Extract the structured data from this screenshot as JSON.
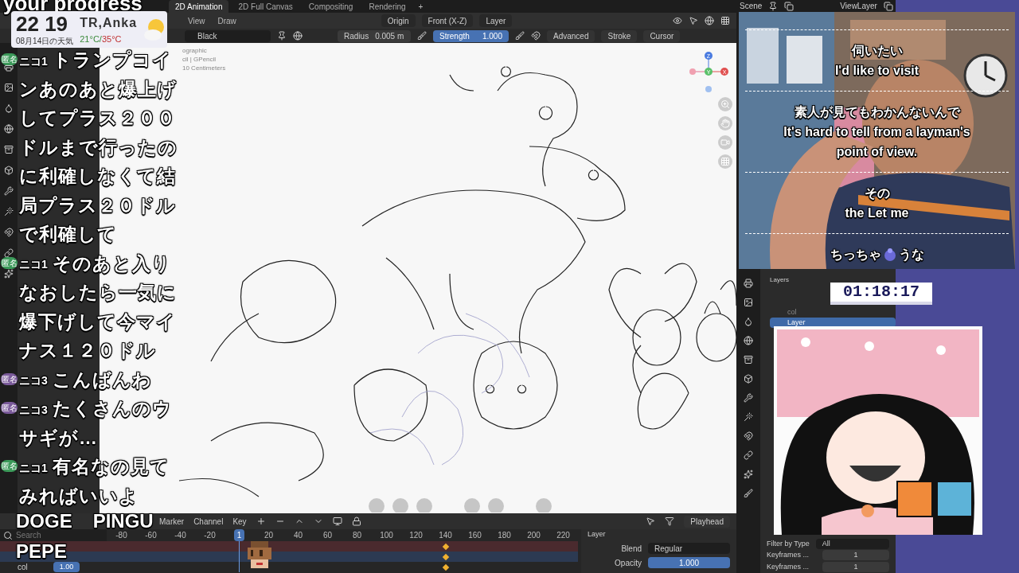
{
  "stream": {
    "caption": "your progress",
    "clock": {
      "time": "22 19",
      "place": "TR,Anka",
      "date": "08月14日の天気",
      "low": "21°C/",
      "high": "35°C"
    },
    "chat": [
      {
        "user": "ニコ1",
        "text": "トランプコインあのあと爆上げしてプラス２００ドルまで行ったのに利確しなくて結局プラス２０ドルで利確して",
        "badge": "匿名",
        "color": "#3c9a5a"
      },
      {
        "user": "ニコ1",
        "text": "そのあと入りなおしたら一気に爆下げして今マイナス１２０ドル",
        "badge": "匿名",
        "color": "#3c9a5a"
      },
      {
        "user": "ニコ3",
        "text": "こんばんわ",
        "badge": "匿名",
        "color": "#7a5a9a"
      },
      {
        "user": "ニコ3",
        "text": "たくさんのウサギが…",
        "badge": "匿名",
        "color": "#7a5a9a"
      },
      {
        "user": "ニコ1",
        "text": "有名なの見てみればいいよ",
        "badge": "匿名",
        "color": "#3c9a5a"
      }
    ],
    "emotes": [
      "DOGE",
      "PINGU",
      "PEPE"
    ],
    "subtitles": [
      {
        "kind": "plain",
        "lines": [
          "伺いたい",
          "I'd like to visit"
        ]
      },
      {
        "kind": "plain",
        "lines": [
          "素人が見てもわかんないんで",
          "It's hard to tell from a layman's",
          "point of view."
        ]
      },
      {
        "kind": "plain",
        "lines": [
          "その",
          "the Let me"
        ]
      },
      {
        "kind": "covered",
        "lines": [
          "ちっちゃ",
          "うな"
        ]
      }
    ],
    "timer": "01:18:17"
  },
  "blender": {
    "workspace_tabs": [
      {
        "label": "2D Animation",
        "selected": true
      },
      {
        "label": "2D Full Canvas",
        "selected": false
      },
      {
        "label": "Compositing",
        "selected": false
      },
      {
        "label": "Rendering",
        "selected": false
      }
    ],
    "add_workspace": "+",
    "scene": "Scene",
    "view_layer": "ViewLayer",
    "header": {
      "menus": [
        "View",
        "Draw"
      ],
      "pivot": "Origin",
      "view": "Front (X-Z)",
      "layer": "Layer"
    },
    "tool_settings": {
      "material": "Black",
      "radius": {
        "label": "Radius",
        "value": "0.005 m"
      },
      "strength": {
        "label": "Strength",
        "value": "1.000",
        "level": 1
      },
      "menus": [
        "Advanced",
        "Stroke",
        "Cursor"
      ]
    },
    "viewport": {
      "info": [
        "ographic",
        "cil | GPencil",
        "10 Centimeters"
      ],
      "axes": [
        "Z",
        "Y",
        "X"
      ]
    },
    "timeline": {
      "menus": [
        "Marker",
        "Channel",
        "Key"
      ],
      "playhead": "Playhead",
      "search_placeholder": "Search",
      "channel": "col",
      "channel_value": "1.00",
      "frames": [
        {
          "label": "-80",
          "selected": false,
          "keyframe": false
        },
        {
          "label": "-60",
          "selected": false,
          "keyframe": false
        },
        {
          "label": "-40",
          "selected": false,
          "keyframe": false
        },
        {
          "label": "-20",
          "selected": false,
          "keyframe": false
        },
        {
          "label": "1",
          "selected": true,
          "keyframe": false
        },
        {
          "label": "20",
          "selected": false,
          "keyframe": false
        },
        {
          "label": "40",
          "selected": false,
          "keyframe": false
        },
        {
          "label": "60",
          "selected": false,
          "keyframe": false
        },
        {
          "label": "80",
          "selected": false,
          "keyframe": false
        },
        {
          "label": "100",
          "selected": false,
          "keyframe": false
        },
        {
          "label": "120",
          "selected": false,
          "keyframe": false
        },
        {
          "label": "140",
          "selected": false,
          "keyframe": true
        },
        {
          "label": "160",
          "selected": false,
          "keyframe": false
        },
        {
          "label": "180",
          "selected": false,
          "keyframe": false
        },
        {
          "label": "200",
          "selected": false,
          "keyframe": false
        },
        {
          "label": "220",
          "selected": false,
          "keyframe": false
        }
      ]
    },
    "layer_panel": {
      "title": "Layer",
      "blend_label": "Blend",
      "blend": "Regular",
      "opacity": {
        "label": "Opacity",
        "value": "1.000",
        "level": 1
      }
    },
    "outliner": {
      "title": "Layers",
      "layers": [
        {
          "name": "col",
          "selected": false
        },
        {
          "name": "Layer",
          "selected": true
        }
      ],
      "filter_label": "Filter by Type",
      "filter": "All",
      "keyframes": [
        {
          "label": "Keyframes ...",
          "value": "1"
        },
        {
          "label": "Keyframes ...",
          "value": "1"
        }
      ]
    }
  }
}
